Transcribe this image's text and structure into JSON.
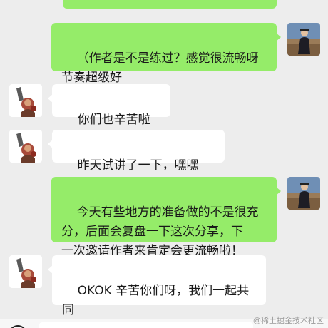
{
  "messages": [
    {
      "side": "right",
      "text": "（作者是不是练过？感觉很流畅呀\n节奏超级好",
      "avatar": "user-photo-avatar"
    },
    {
      "side": "left",
      "text": "你们也辛苦啦",
      "emoji": "sweat-smile-emoji",
      "avatar": "warrior-avatar"
    },
    {
      "side": "left",
      "text": "昨天试讲了一下，嘿嘿",
      "emoji": "doge-emoji",
      "avatar": "warrior-avatar"
    },
    {
      "side": "right",
      "text": "今天有些地方的准备做的不是很充\n分，后面会复盘一下这次分享，下\n一次邀请作者来肯定会更流畅啦！",
      "avatar": "user-photo-avatar"
    },
    {
      "side": "left",
      "text": "OKOK 辛苦你们呀，我们一起共同\n成长",
      "emoji": "grin-emoji",
      "avatar": "warrior-avatar"
    }
  ],
  "watermark": "@稀土掘金技术社区",
  "colors": {
    "background": "#ededed",
    "sent_bubble": "#95ec69",
    "received_bubble": "#ffffff"
  }
}
